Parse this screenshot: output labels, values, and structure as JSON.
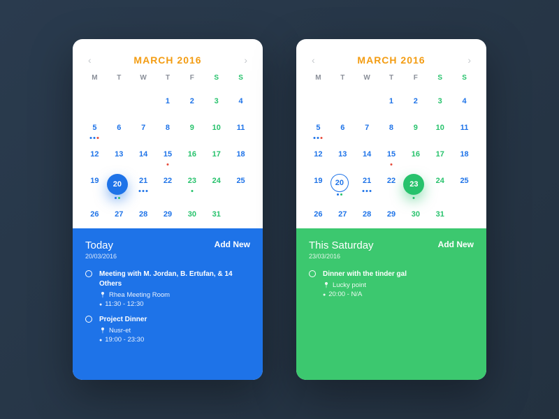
{
  "cards": [
    {
      "month": "MARCH 2016",
      "footerColor": "blue",
      "dayLabel": "Today",
      "dayDate": "20/03/2016",
      "addNew": "Add New",
      "events": [
        {
          "title": "Meeting with M. Jordan, B. Ertufan, & 14 Others",
          "location": "Rhea Meeting Room",
          "time": "11:30 - 12:30"
        },
        {
          "title": "Project Dinner",
          "location": "Nusr-et",
          "time": "19:00 - 23:30"
        }
      ],
      "cells": [
        {
          "n": "",
          "cls": "empty"
        },
        {
          "n": "1",
          "cls": "wd"
        },
        {
          "n": "2",
          "cls": "wd"
        },
        {
          "n": "3",
          "cls": "we"
        },
        {
          "n": "4",
          "cls": "wd"
        },
        {
          "n": "5",
          "cls": "wd",
          "dots": [
            "d-blue",
            "d-blue",
            "d-red"
          ]
        },
        {
          "n": "6",
          "cls": "wd"
        },
        {
          "n": "7",
          "cls": "wd"
        },
        {
          "n": "8",
          "cls": "wd"
        },
        {
          "n": "9",
          "cls": "we"
        },
        {
          "n": "10",
          "cls": "we"
        },
        {
          "n": "11",
          "cls": "wd"
        },
        {
          "n": "12",
          "cls": "wd"
        },
        {
          "n": "13",
          "cls": "wd"
        },
        {
          "n": "14",
          "cls": "wd"
        },
        {
          "n": "15",
          "cls": "wd",
          "dots": [
            "d-red"
          ]
        },
        {
          "n": "16",
          "cls": "we"
        },
        {
          "n": "17",
          "cls": "we"
        },
        {
          "n": "18",
          "cls": "wd"
        },
        {
          "n": "19",
          "cls": "wd"
        },
        {
          "n": "20",
          "cls": "sel-blue",
          "dots": [
            "d-blue",
            "d-green"
          ],
          "selected": true
        },
        {
          "n": "21",
          "cls": "wd",
          "dots": [
            "d-blue",
            "d-blue",
            "d-blue"
          ]
        },
        {
          "n": "22",
          "cls": "wd"
        },
        {
          "n": "23",
          "cls": "we",
          "dots": [
            "d-green"
          ]
        },
        {
          "n": "24",
          "cls": "we"
        },
        {
          "n": "25",
          "cls": "wd"
        },
        {
          "n": "26",
          "cls": "wd"
        },
        {
          "n": "27",
          "cls": "wd"
        },
        {
          "n": "28",
          "cls": "wd"
        },
        {
          "n": "29",
          "cls": "wd"
        },
        {
          "n": "30",
          "cls": "we"
        },
        {
          "n": "31",
          "cls": "we"
        }
      ]
    },
    {
      "month": "MARCH 2016",
      "footerColor": "green",
      "dayLabel": "This Saturday",
      "dayDate": "23/03/2016",
      "addNew": "Add New",
      "events": [
        {
          "title": "Dinner with the tinder gal",
          "location": "Lucky point",
          "time": "20:00 - N/A"
        }
      ],
      "cells": [
        {
          "n": "",
          "cls": "empty"
        },
        {
          "n": "1",
          "cls": "wd"
        },
        {
          "n": "2",
          "cls": "wd"
        },
        {
          "n": "3",
          "cls": "we"
        },
        {
          "n": "4",
          "cls": "wd"
        },
        {
          "n": "5",
          "cls": "wd",
          "dots": [
            "d-blue",
            "d-blue",
            "d-red"
          ]
        },
        {
          "n": "6",
          "cls": "wd"
        },
        {
          "n": "7",
          "cls": "wd"
        },
        {
          "n": "8",
          "cls": "wd"
        },
        {
          "n": "9",
          "cls": "we"
        },
        {
          "n": "10",
          "cls": "we"
        },
        {
          "n": "11",
          "cls": "wd"
        },
        {
          "n": "12",
          "cls": "wd"
        },
        {
          "n": "13",
          "cls": "wd"
        },
        {
          "n": "14",
          "cls": "wd"
        },
        {
          "n": "15",
          "cls": "wd",
          "dots": [
            "d-red"
          ]
        },
        {
          "n": "16",
          "cls": "we"
        },
        {
          "n": "17",
          "cls": "we"
        },
        {
          "n": "18",
          "cls": "wd"
        },
        {
          "n": "19",
          "cls": "wd"
        },
        {
          "n": "20",
          "cls": "ring-blue",
          "dots": [
            "d-blue",
            "d-green"
          ]
        },
        {
          "n": "21",
          "cls": "wd",
          "dots": [
            "d-blue",
            "d-blue",
            "d-blue"
          ]
        },
        {
          "n": "22",
          "cls": "wd"
        },
        {
          "n": "23",
          "cls": "sel-green",
          "dots": [
            "d-green"
          ],
          "selected": true
        },
        {
          "n": "24",
          "cls": "we"
        },
        {
          "n": "25",
          "cls": "wd"
        },
        {
          "n": "26",
          "cls": "wd"
        },
        {
          "n": "27",
          "cls": "wd"
        },
        {
          "n": "28",
          "cls": "wd"
        },
        {
          "n": "29",
          "cls": "wd"
        },
        {
          "n": "30",
          "cls": "we"
        },
        {
          "n": "31",
          "cls": "we"
        }
      ]
    }
  ],
  "dow": [
    "M",
    "T",
    "W",
    "T",
    "F",
    "S",
    "S"
  ]
}
